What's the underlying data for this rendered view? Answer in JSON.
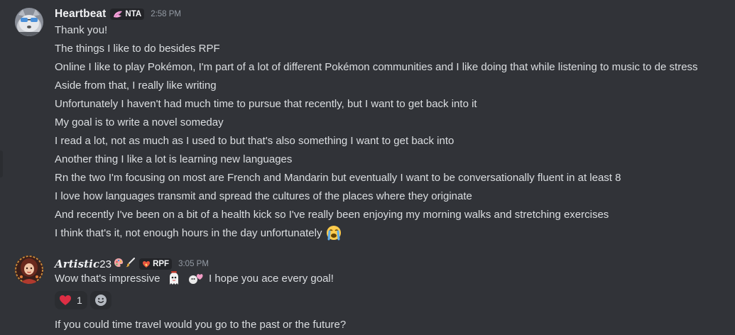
{
  "messages": [
    {
      "author": "Heartbeat",
      "tag": "NTA",
      "time": "2:58 PM",
      "lines": [
        "Thank you!",
        "The things I like to do besides RPF",
        "Online I like to play Pokémon, I'm part of a lot of different Pokémon communities and I like doing that while listening to music to de stress",
        "Aside from that, I really like writing",
        "Unfortunately I haven't had much time to pursue that recently, but I want to get back into it",
        "My goal is to write a novel someday",
        "I read a lot, not as much as I used to but that's also something I want to get back into",
        "Another thing I like a lot is learning new languages",
        "Rn the two I'm focusing on most are French and Mandarin but eventually I want to be conversationally fluent in at least 8",
        "I love how languages transmit and spread the cultures of the places where they originate",
        "And recently I've been on a bit of a health kick so I've really been enjoying my morning walks and stretching exercises",
        "I think that's it, not enough hours in the day unfortunately"
      ],
      "trailing_emoji": "loudly-crying-face"
    },
    {
      "author_styled": "𝑨𝒓𝒕𝒊𝒔𝒕𝒊𝒄",
      "author_plain": "23",
      "tag": "RPF",
      "time": "3:05 PM",
      "line_start": "Wow that's impressive",
      "line_end": "I hope you ace every goal!",
      "inline_emojis": [
        "custom-emoji-ghost",
        "custom-emoji-heart"
      ],
      "reactions": [
        {
          "emoji": "red-heart",
          "count": "1"
        }
      ]
    },
    {
      "text": "If you could time travel would you go to the past or the future?"
    }
  ],
  "colors": {
    "background": "#313338",
    "text": "#dbdee1",
    "timestamp": "#949ba4",
    "tag_background": "#232428"
  }
}
